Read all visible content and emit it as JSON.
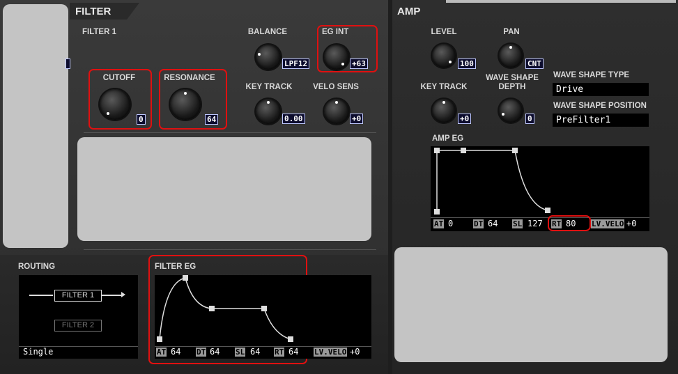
{
  "filter": {
    "title": "FILTER",
    "section": "FILTER 1",
    "cutoff": {
      "label": "CUTOFF",
      "value": "0"
    },
    "resonance": {
      "label": "RESONANCE",
      "value": "64"
    },
    "balance": {
      "label": "BALANCE",
      "value": "LPF12"
    },
    "eg_int": {
      "label": "EG INT",
      "value": "+63"
    },
    "key_track": {
      "label": "KEY TRACK",
      "value": "0.00"
    },
    "velo_sens": {
      "label": "VELO SENS",
      "value": "+0"
    }
  },
  "routing": {
    "label": "ROUTING",
    "filter1": "FILTER 1",
    "filter2": "FILTER 2",
    "mode": "Single"
  },
  "filter_eg": {
    "label": "FILTER EG",
    "at": {
      "tag": "AT",
      "value": "64"
    },
    "dt": {
      "tag": "DT",
      "value": "64"
    },
    "sl": {
      "tag": "SL",
      "value": "64"
    },
    "rt": {
      "tag": "RT",
      "value": "64"
    },
    "lv": {
      "tag": "LV.VELO",
      "value": "+0"
    }
  },
  "amp": {
    "title": "AMP",
    "level": {
      "label": "LEVEL",
      "value": "100"
    },
    "pan": {
      "label": "PAN",
      "value": "CNT"
    },
    "key_track": {
      "label": "KEY TRACK",
      "value": "+0"
    },
    "wave_shape_depth": {
      "label1": "WAVE SHAPE",
      "label2": "DEPTH",
      "value": "0"
    },
    "wave_shape_type": {
      "label": "WAVE SHAPE TYPE",
      "value": "Drive"
    },
    "wave_shape_position": {
      "label": "WAVE SHAPE POSITION",
      "value": "PreFilter1"
    }
  },
  "amp_eg": {
    "label": "AMP EG",
    "at": {
      "tag": "AT",
      "value": "0"
    },
    "dt": {
      "tag": "DT",
      "value": "64"
    },
    "sl": {
      "tag": "SL",
      "value": "127"
    },
    "rt": {
      "tag": "RT",
      "value": "80"
    },
    "lv": {
      "tag": "LV.VELO",
      "value": "+0"
    }
  },
  "colors": {
    "highlight": "#e01010",
    "value_bg": "#0d0d2e",
    "redaction": "#c4c4c4"
  }
}
